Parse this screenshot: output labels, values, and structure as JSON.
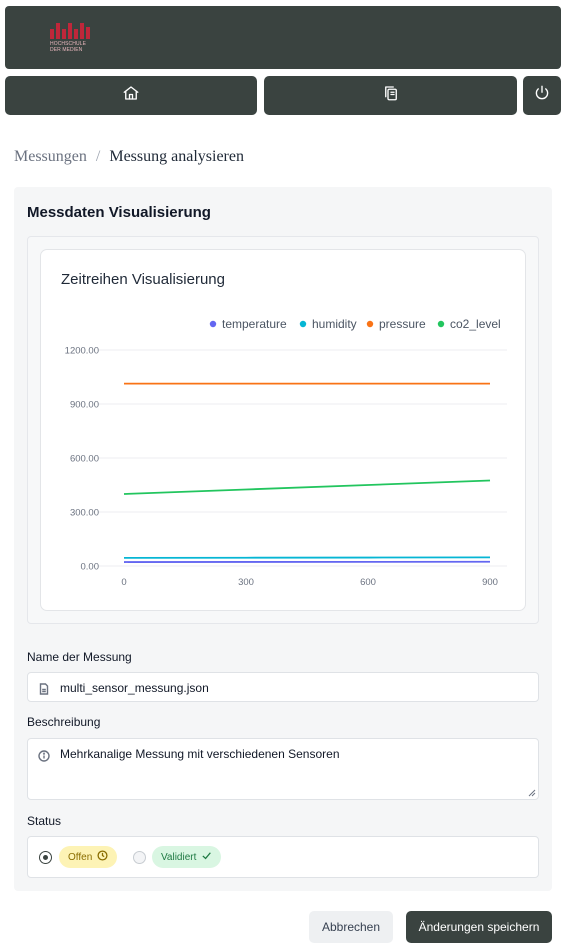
{
  "logo": {
    "name": "hdm-logo",
    "text_line1": "HOCHSCHULE",
    "text_line2": "DER MEDIEN"
  },
  "nav": [
    {
      "icon": "home-icon"
    },
    {
      "icon": "copy-icon"
    },
    {
      "icon": "power-icon"
    }
  ],
  "breadcrumb": {
    "parent": "Messungen",
    "separator": "/",
    "current": "Messung analysieren"
  },
  "panel": {
    "title": "Messdaten Visualisierung"
  },
  "chart": {
    "title": "Zeitreihen Visualisierung"
  },
  "chart_data": {
    "type": "line",
    "title": "Zeitreihen Visualisierung",
    "x": [
      0,
      300,
      600,
      900
    ],
    "x_ticks": [
      "0",
      "300",
      "600",
      "900"
    ],
    "y_ticks": [
      "0.00",
      "300.00",
      "600.00",
      "900.00",
      "1200.00"
    ],
    "ylim": [
      0,
      1200
    ],
    "xlim": [
      0,
      900
    ],
    "grid": true,
    "legend": "top-right",
    "series": [
      {
        "name": "temperature",
        "color": "#6366f1",
        "values": [
          22,
          22.5,
          23,
          23.5
        ]
      },
      {
        "name": "humidity",
        "color": "#06b6d4",
        "values": [
          45,
          46,
          47,
          48
        ]
      },
      {
        "name": "pressure",
        "color": "#f97316",
        "values": [
          1013,
          1013,
          1013,
          1013
        ]
      },
      {
        "name": "co2_level",
        "color": "#22c55e",
        "values": [
          400,
          425,
          450,
          475
        ]
      }
    ]
  },
  "form": {
    "name_label": "Name der Messung",
    "name_value": "multi_sensor_messung.json",
    "desc_label": "Beschreibung",
    "desc_value": "Mehrkanalige Messung mit verschiedenen Sensoren",
    "status_label": "Status",
    "status_options": [
      {
        "label": "Offen",
        "selected": true,
        "icon": "clock-icon"
      },
      {
        "label": "Validiert",
        "selected": false,
        "icon": "check-icon"
      }
    ]
  },
  "actions": {
    "cancel": "Abbrechen",
    "save": "Änderungen speichern"
  }
}
